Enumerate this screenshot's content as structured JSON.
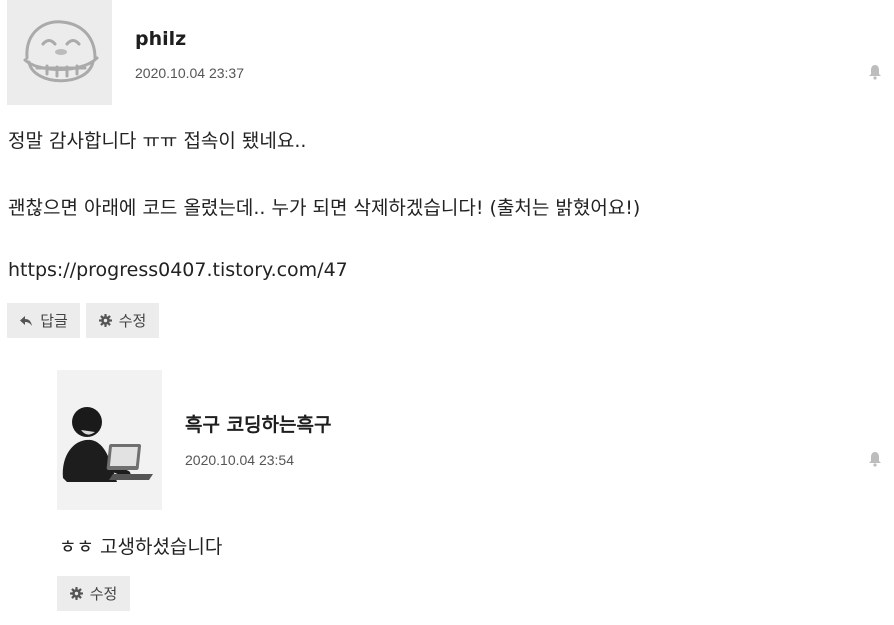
{
  "comments": [
    {
      "author": "philz",
      "timestamp": "2020.10.04 23:37",
      "avatar_icon": "laughing-face-avatar",
      "lines": [
        "정말 감사합니다 ㅠㅠ 접속이 됐네요..",
        "괜찮으면 아래에 코드 올렸는데.. 누가 되면 삭제하겠습니다! (출처는 밝혔어요!)",
        "https://progress0407.tistory.com/47"
      ],
      "reply_label": "답글",
      "edit_label": "수정"
    }
  ],
  "replies": [
    {
      "author": "흑구 코딩하는흑구",
      "timestamp": "2020.10.04 23:54",
      "avatar_icon": "person-at-laptop-avatar",
      "lines": [
        "ㅎㅎ 고생하셨습니다"
      ],
      "edit_label": "수정"
    }
  ],
  "icons": {
    "reply": "reply-arrow-icon",
    "edit": "gear-icon",
    "notify": "bell-icon"
  },
  "colors": {
    "button_bg": "#ececec",
    "avatar_bg": "#ececec",
    "text": "#222222",
    "muted": "#555555"
  }
}
